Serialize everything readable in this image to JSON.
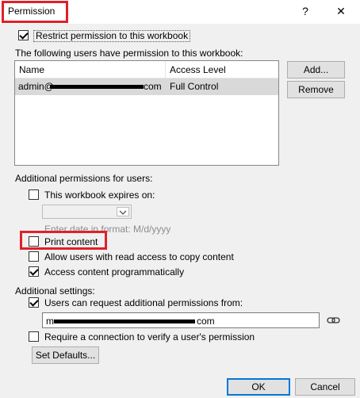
{
  "window": {
    "title": "Permission",
    "help_glyph": "?",
    "close_glyph": "✕"
  },
  "restrict": {
    "label": "Restrict permission to this workbook",
    "checked": true
  },
  "users_section": {
    "label": "The following users have permission to this workbook:",
    "columns": [
      "Name",
      "Access Level"
    ],
    "rows": [
      {
        "name_prefix": "admin@",
        "name_suffix": "com",
        "access": "Full Control"
      }
    ],
    "add_label": "Add...",
    "remove_label": "Remove"
  },
  "additional_permissions": {
    "label": "Additional permissions for users:",
    "expires": {
      "label": "This workbook expires on:",
      "checked": false
    },
    "date_hint": "Enter date in format: M/d/yyyy",
    "print": {
      "label": "Print content",
      "checked": false
    },
    "copy": {
      "label": "Allow users with read access to copy content",
      "checked": false
    },
    "programmatic": {
      "label": "Access content programmatically",
      "checked": true
    }
  },
  "additional_settings": {
    "label": "Additional settings:",
    "request": {
      "label": "Users can request additional permissions from:",
      "checked": true
    },
    "email_prefix": "m",
    "email_suffix": "com",
    "require": {
      "label": "Require a connection to verify a user's permission",
      "checked": false
    },
    "set_defaults_label": "Set Defaults..."
  },
  "footer": {
    "ok_label": "OK",
    "cancel_label": "Cancel"
  },
  "colors": {
    "highlight_red": "#e0202a",
    "accent_blue": "#0078d7"
  }
}
